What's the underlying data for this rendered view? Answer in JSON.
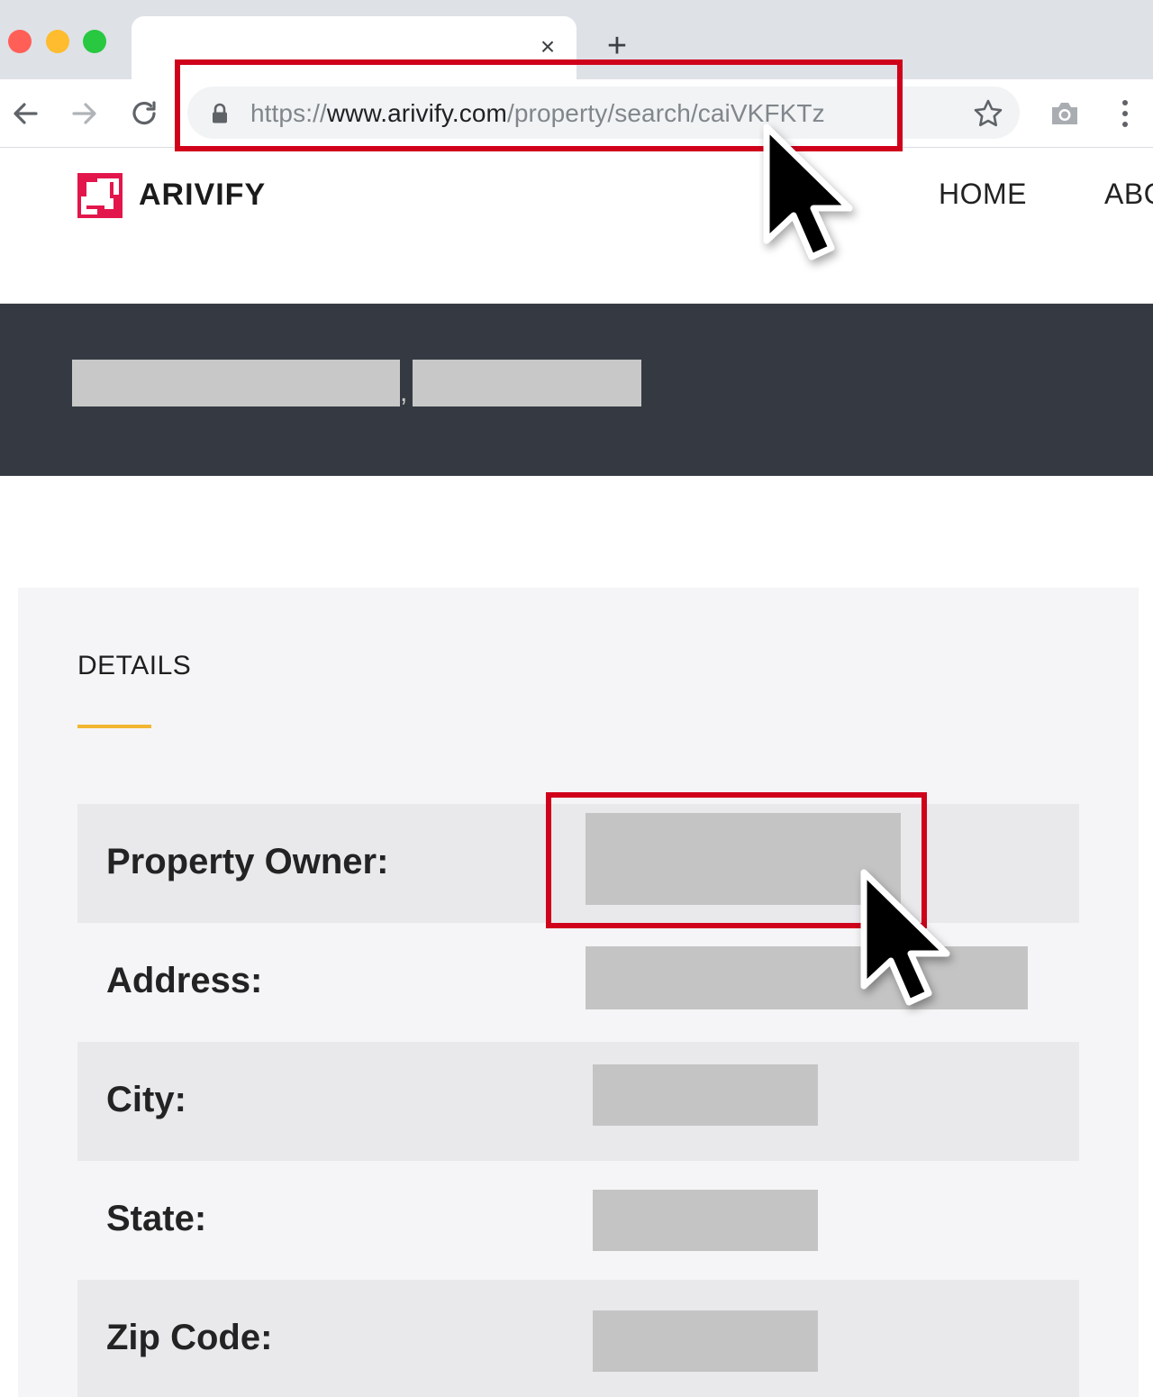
{
  "browser": {
    "tab": {
      "close_glyph": "×"
    },
    "new_tab_glyph": "+",
    "url": {
      "scheme": "https://",
      "host": "www.arivify.com",
      "path": "/property/search/caiVKFKTz"
    },
    "icons": [
      "arrow-left-icon",
      "arrow-right-icon",
      "reload-icon",
      "lock-icon",
      "star-icon",
      "camera-icon",
      "kebab-menu-icon"
    ]
  },
  "site": {
    "logo_text": "ARIVIFY",
    "nav": [
      "HOME",
      "ABOUT"
    ],
    "brand_color": "#e3164c"
  },
  "banner": {
    "separator": ","
  },
  "details": {
    "heading": "DETAILS",
    "accent_color": "#f2b632",
    "rows": [
      {
        "label": "Property Owner:"
      },
      {
        "label": "Address:"
      },
      {
        "label": "City:"
      },
      {
        "label": "State:"
      },
      {
        "label": "Zip Code:"
      }
    ]
  },
  "annotation": {
    "highlight_color": "#d0021b"
  }
}
